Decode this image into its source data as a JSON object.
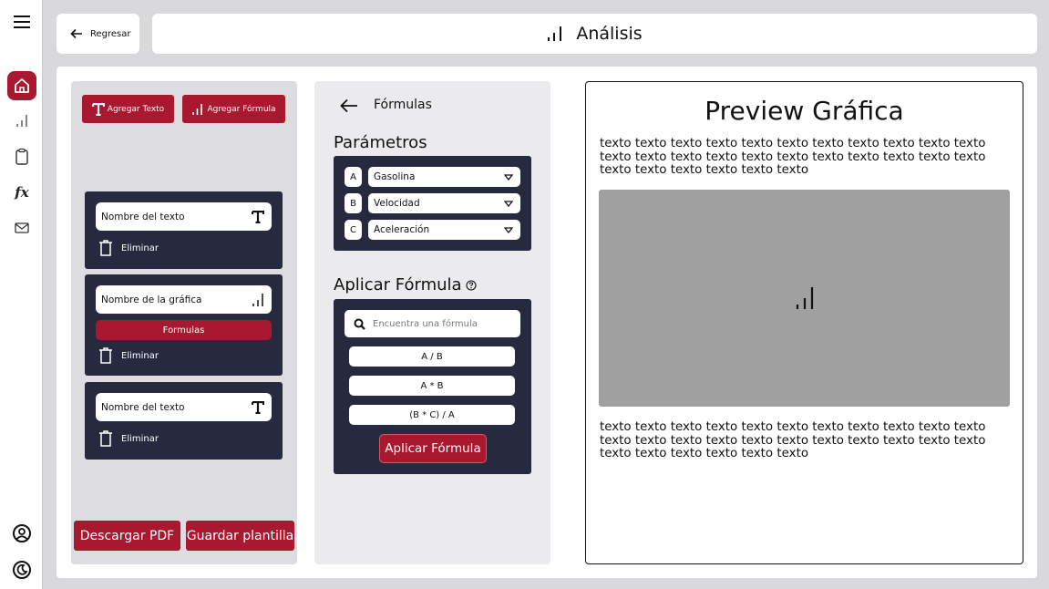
{
  "sidebar": {
    "items": [
      {
        "icon": "menu-icon"
      },
      {
        "icon": "home-icon",
        "active": true
      },
      {
        "icon": "chart-icon"
      },
      {
        "icon": "clipboard-icon"
      },
      {
        "icon": "function-icon",
        "glyph": "fx"
      },
      {
        "icon": "mail-icon"
      },
      {
        "icon": "user-icon"
      },
      {
        "icon": "theme-icon"
      }
    ]
  },
  "header": {
    "back_label": "Regresar",
    "title": "Análisis"
  },
  "builder": {
    "add_text_label": "Agregar Texto",
    "add_formula_label": "Agregar Fórmula",
    "blocks": [
      {
        "name": "Nombre del texto",
        "delete_label": "Eliminar"
      },
      {
        "name": "Nombre de la gráfica",
        "formulas_label": "Formulas",
        "delete_label": "Eliminar"
      },
      {
        "name": "Nombre del texto",
        "delete_label": "Eliminar"
      }
    ],
    "download_label": "Descargar PDF",
    "save_label": "Guardar plantilla"
  },
  "formulas": {
    "title": "Fórmulas",
    "params_title": "Parámetros",
    "params": [
      {
        "letter": "A",
        "value": "Gasolina"
      },
      {
        "letter": "B",
        "value": "Velocidad"
      },
      {
        "letter": "C",
        "value": "Aceleración"
      }
    ],
    "apply_title": "Aplicar Fórmula",
    "search_placeholder": "Encuentra una fórmula",
    "options": [
      "A / B",
      "A * B",
      "(B * C) / A"
    ],
    "apply_label": "Aplicar Fórmula"
  },
  "preview": {
    "title": "Preview Gráfica",
    "text_top": "texto texto texto texto texto texto texto texto texto texto texto texto texto texto texto texto texto texto texto texto texto texto texto texto texto texto texto texto",
    "text_bottom": "texto texto texto texto texto texto texto texto texto texto texto texto texto texto texto texto texto texto texto texto texto texto texto texto texto texto texto texto"
  },
  "colors": {
    "accent": "#a8182e",
    "panel_dark": "#272a3e",
    "background": "#d9d9dc"
  }
}
